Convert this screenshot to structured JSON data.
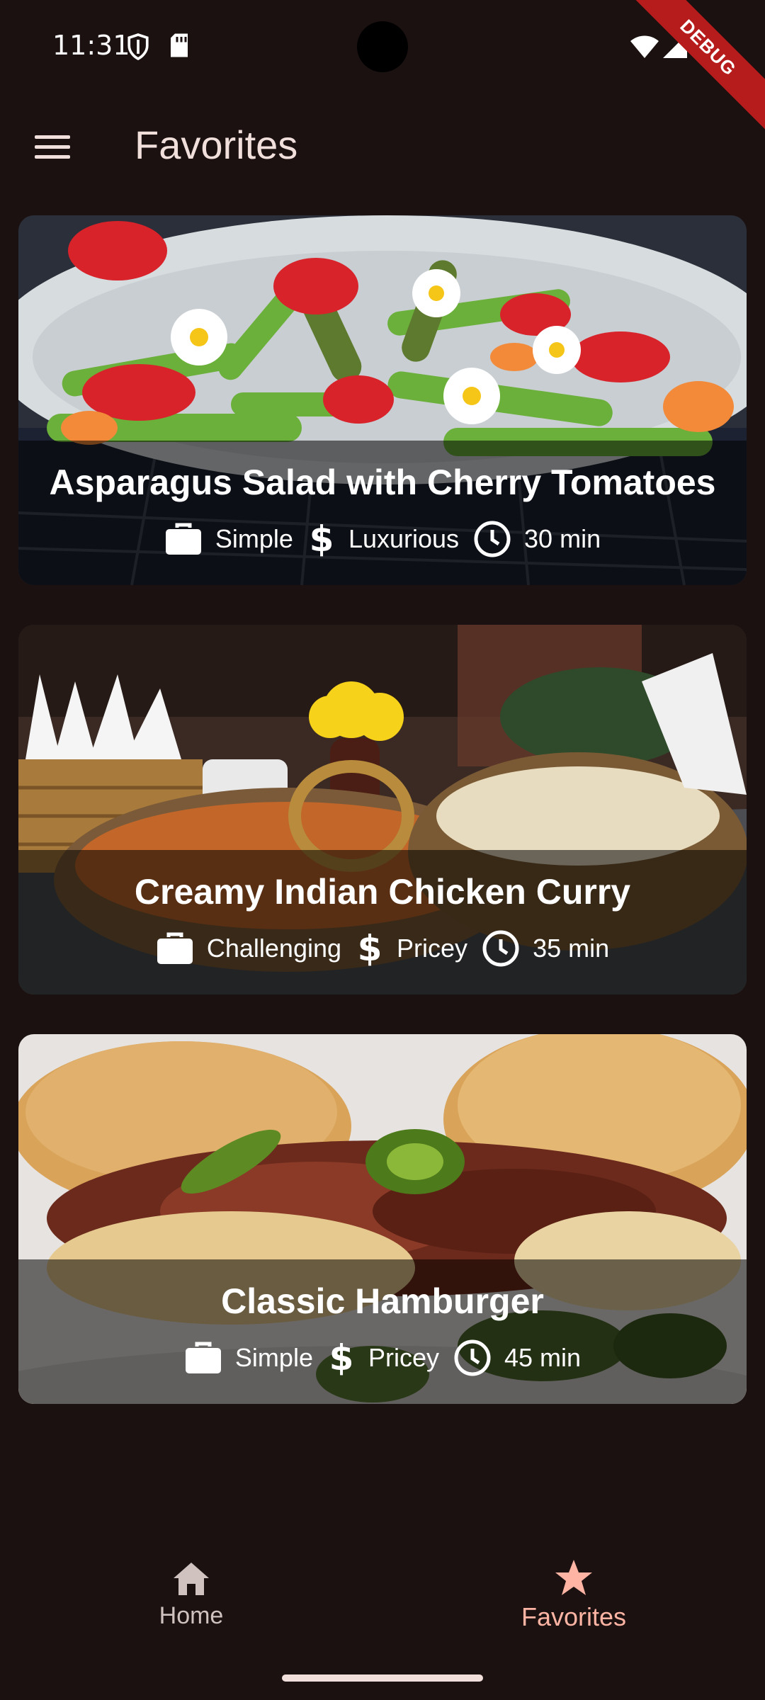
{
  "status_bar": {
    "time": "11:31",
    "icons": [
      "shield-icon",
      "sd-card-icon",
      "wifi-icon",
      "signal-icon",
      "battery-icon"
    ]
  },
  "debug_banner": "DEBUG",
  "app_bar": {
    "menu_icon": "menu-icon",
    "title": "Favorites"
  },
  "meals": [
    {
      "title": "Asparagus Salad with Cherry Tomatoes",
      "complexity": "Simple",
      "affordability": "Luxurious",
      "duration": "30 min",
      "image_description": "salad"
    },
    {
      "title": "Creamy Indian Chicken Curry",
      "complexity": "Challenging",
      "affordability": "Pricey",
      "duration": "35 min",
      "image_description": "curry"
    },
    {
      "title": "Classic Hamburger",
      "complexity": "Simple",
      "affordability": "Pricey",
      "duration": "45 min",
      "image_description": "hamburger"
    }
  ],
  "bottom_nav": {
    "items": [
      {
        "label": "Home",
        "icon": "home-icon",
        "color": "#cfc2bf"
      },
      {
        "label": "Favorites",
        "icon": "star-icon",
        "color": "#ffb4a4"
      }
    ],
    "selected": 1
  },
  "colors": {
    "background": "#1a1110",
    "accent": "#ffb4a4",
    "on_surface": "#f0dfdb"
  }
}
